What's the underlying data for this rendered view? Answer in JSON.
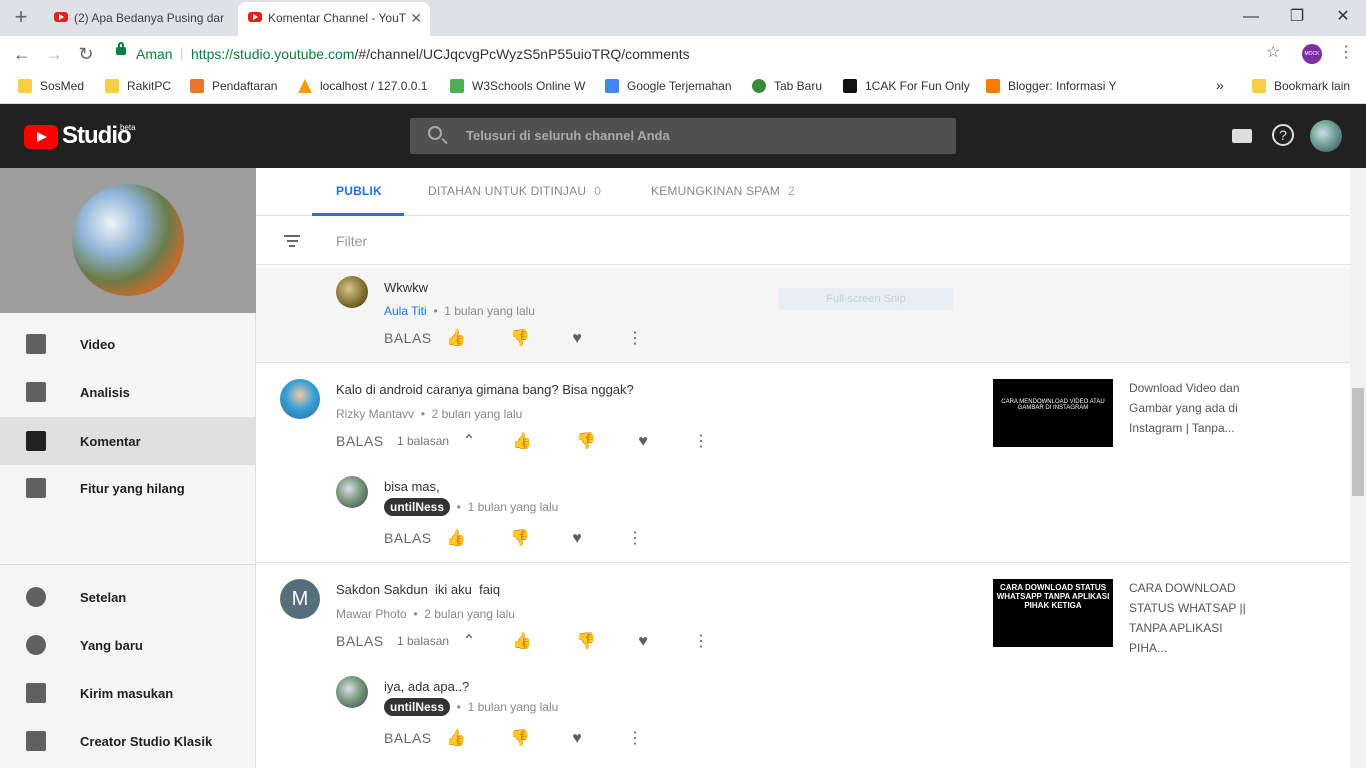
{
  "browser": {
    "tabs": [
      {
        "title": "(2) Apa Bedanya Pusing dan ",
        "active": false
      },
      {
        "title": "Komentar Channel - YouT",
        "active": true
      }
    ],
    "secure_label": "Aman",
    "url_domain": "https://studio.youtube.com",
    "url_path": "/#/channel/UCJqcvgPcWyzS5nP55uioTRQ/comments",
    "bookmarks": [
      "SosMed",
      "RakitPC",
      "Pendaftaran",
      "localhost / 127.0.0.1",
      "W3Schools Online W",
      "Google Terjemahan",
      "Tab Baru",
      "1CAK For Fun Only",
      "Blogger: Informasi Y"
    ],
    "bookmarks_other": "Bookmark lain",
    "overflow": "»",
    "ext_label": "MOCK TOLE"
  },
  "header": {
    "logo_text": "Studio",
    "beta": "beta",
    "search_placeholder": "Telusuri di seluruh channel Anda"
  },
  "sidebar": {
    "items": [
      {
        "label": "Video",
        "icon": "video-icon"
      },
      {
        "label": "Analisis",
        "icon": "analytics-icon"
      },
      {
        "label": "Komentar",
        "icon": "comments-icon",
        "selected": true
      },
      {
        "label": "Fitur yang hilang",
        "icon": "missing-features-icon"
      }
    ],
    "bottom_items": [
      {
        "label": "Setelan",
        "icon": "gear-icon"
      },
      {
        "label": "Yang baru",
        "icon": "whats-new-icon"
      },
      {
        "label": "Kirim masukan",
        "icon": "feedback-icon"
      },
      {
        "label": "Creator Studio Klasik",
        "icon": "classic-icon"
      }
    ]
  },
  "comment_tabs": [
    {
      "label": "PUBLIK",
      "count": ""
    },
    {
      "label": "DITAHAN UNTUK DITINJAU",
      "count": "0"
    },
    {
      "label": "KEMUNGKINAN SPAM",
      "count": "2"
    }
  ],
  "filter_placeholder": "Filter",
  "snip_label": "Full-screen Snip",
  "reply_label": "BALAS",
  "comments": [
    {
      "text": "Wkwkw",
      "author": "Aula Titi",
      "time": "1 bulan yang lalu"
    },
    {
      "text": "Kalo di android caranya gimana bang? Bisa nggak?",
      "author": "Rizky Mantavv",
      "time": "2 bulan yang lalu",
      "replies": "1 balasan",
      "video_title": "Download Video dan Gambar yang ada di Instagram | Tanpa...",
      "thumb_text": "CARA MENDOWNLOAD VIDEO ATAU GAMBAR DI INSTAGRAM"
    },
    {
      "text": "bisa mas,",
      "author": "untilNess",
      "time": "1 bulan yang lalu"
    },
    {
      "text": "Sakdon Sakdun  iki aku  faiq",
      "author": "Mawar Photo",
      "time": "2 bulan yang lalu",
      "replies": "1 balasan",
      "avatar_letter": "M",
      "video_title": "CARA DOWNLOAD STATUS WHATSAP || TANPA APLIKASI PIHA...",
      "thumb_text": "CARA DOWNLOAD STATUS WHATSAPP TANPA APLIKASI PIHAK KETIGA"
    },
    {
      "text": "iya, ada apa..?",
      "author": "untilNess",
      "time": "1 bulan yang lalu"
    }
  ]
}
